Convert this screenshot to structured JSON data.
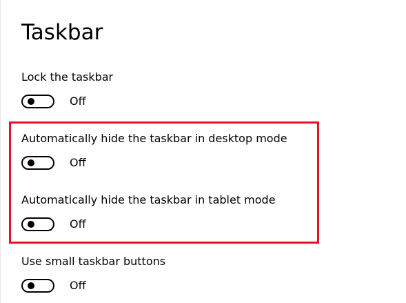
{
  "page": {
    "title": "Taskbar"
  },
  "settings": [
    {
      "label": "Lock the taskbar",
      "state": "Off"
    },
    {
      "label": "Automatically hide the taskbar in desktop mode",
      "state": "Off"
    },
    {
      "label": "Automatically hide the taskbar in tablet mode",
      "state": "Off"
    },
    {
      "label": "Use small taskbar buttons",
      "state": "Off"
    }
  ],
  "colors": {
    "highlight": "#e81123",
    "background": "#ffffff",
    "text": "#000000"
  }
}
